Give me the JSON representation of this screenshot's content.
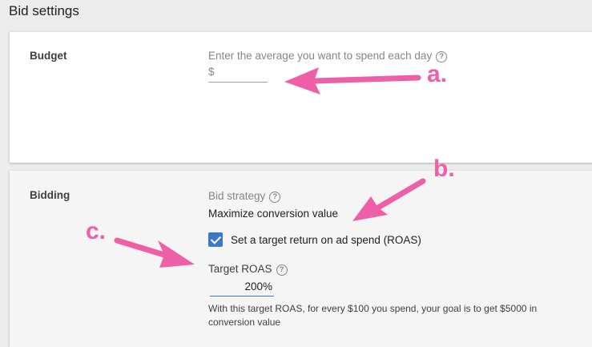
{
  "page": {
    "title": "Bid settings"
  },
  "budget": {
    "section_label": "Budget",
    "field_label": "Enter the average you want to spend each day",
    "help_icon_glyph": "?",
    "currency_prefix": "$",
    "value": ""
  },
  "bidding": {
    "section_label": "Bidding",
    "strategy_label": "Bid strategy",
    "strategy_help_icon_glyph": "?",
    "strategy_value": "Maximize conversion value",
    "roas_checkbox": {
      "label": "Set a target return on ad spend (ROAS)",
      "checked": true
    },
    "target_roas_label": "Target ROAS",
    "target_roas_help_icon_glyph": "?",
    "target_roas_value": "200%",
    "helper_text": "With this target ROAS, for every $100 you spend, your goal is to get $5000 in conversion value"
  },
  "annotations": {
    "color": "#ef5fa7",
    "letters": [
      "a.",
      "b.",
      "c."
    ]
  },
  "colors": {
    "accent_blue": "#3c78c8",
    "annotation_pink": "#ef5fa7",
    "card_background": "#ffffff",
    "page_background": "#ececec"
  }
}
